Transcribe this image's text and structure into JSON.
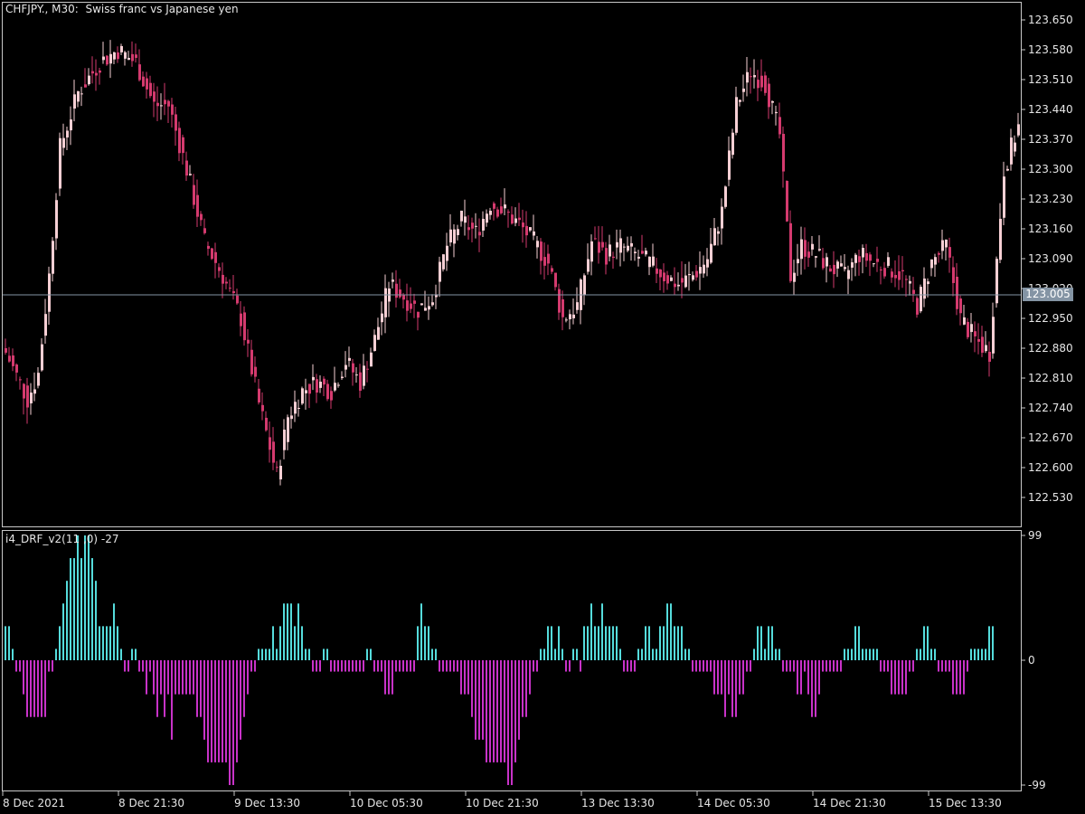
{
  "header": {
    "symbol_label": "CHFJPY., M30:",
    "description": "Swiss franc vs Japanese yen"
  },
  "indicator": {
    "label": "i4_DRF_v2(11 ,0) -27"
  },
  "current_price": "123.005",
  "colors": {
    "background": "#000000",
    "frame": "#c8c8c8",
    "bear_candle": "#d43a6e",
    "bull_candle": "#f6cfd4",
    "price_line": "#8494a4",
    "hist_positive": "#55dcdc",
    "hist_negative": "#c832c8"
  },
  "chart_data": [
    {
      "type": "candlestick",
      "title": "CHFJPY., M30:  Swiss franc vs Japanese yen",
      "ylim": [
        122.47,
        123.71
      ],
      "y_ticks": [
        "123.650",
        "123.580",
        "123.510",
        "123.440",
        "123.370",
        "123.300",
        "123.230",
        "123.160",
        "123.090",
        "123.020",
        "122.950",
        "122.880",
        "122.810",
        "122.740",
        "122.670",
        "122.600",
        "122.530"
      ],
      "x_ticks": [
        "8 Dec 2021",
        "8 Dec 21:30",
        "9 Dec 13:30",
        "10 Dec 05:30",
        "10 Dec 21:30",
        "13 Dec 13:30",
        "14 Dec 05:30",
        "14 Dec 21:30",
        "15 Dec 13:30"
      ],
      "close_anchors": [
        {
          "bar": 0,
          "close": 122.87
        },
        {
          "bar": 6,
          "close": 122.76
        },
        {
          "bar": 9,
          "close": 122.82
        },
        {
          "bar": 12,
          "close": 123.05
        },
        {
          "bar": 15,
          "close": 123.35
        },
        {
          "bar": 20,
          "close": 123.48
        },
        {
          "bar": 26,
          "close": 123.55
        },
        {
          "bar": 31,
          "close": 123.58
        },
        {
          "bar": 36,
          "close": 123.55
        },
        {
          "bar": 41,
          "close": 123.45
        },
        {
          "bar": 45,
          "close": 123.45
        },
        {
          "bar": 50,
          "close": 123.3
        },
        {
          "bar": 55,
          "close": 123.13
        },
        {
          "bar": 60,
          "close": 123.05
        },
        {
          "bar": 65,
          "close": 122.95
        },
        {
          "bar": 70,
          "close": 122.75
        },
        {
          "bar": 75,
          "close": 122.58
        },
        {
          "bar": 78,
          "close": 122.72
        },
        {
          "bar": 82,
          "close": 122.78
        },
        {
          "bar": 86,
          "close": 122.8
        },
        {
          "bar": 90,
          "close": 122.78
        },
        {
          "bar": 94,
          "close": 122.85
        },
        {
          "bar": 98,
          "close": 122.8
        },
        {
          "bar": 102,
          "close": 122.9
        },
        {
          "bar": 106,
          "close": 123.03
        },
        {
          "bar": 110,
          "close": 123.0
        },
        {
          "bar": 114,
          "close": 122.97
        },
        {
          "bar": 118,
          "close": 123.0
        },
        {
          "bar": 122,
          "close": 123.12
        },
        {
          "bar": 126,
          "close": 123.18
        },
        {
          "bar": 130,
          "close": 123.15
        },
        {
          "bar": 134,
          "close": 123.22
        },
        {
          "bar": 138,
          "close": 123.2
        },
        {
          "bar": 142,
          "close": 123.17
        },
        {
          "bar": 146,
          "close": 123.13
        },
        {
          "bar": 150,
          "close": 123.08
        },
        {
          "bar": 154,
          "close": 122.95
        },
        {
          "bar": 158,
          "close": 122.98
        },
        {
          "bar": 162,
          "close": 123.13
        },
        {
          "bar": 166,
          "close": 123.1
        },
        {
          "bar": 170,
          "close": 123.12
        },
        {
          "bar": 174,
          "close": 123.1
        },
        {
          "bar": 178,
          "close": 123.08
        },
        {
          "bar": 182,
          "close": 123.05
        },
        {
          "bar": 186,
          "close": 123.03
        },
        {
          "bar": 190,
          "close": 123.05
        },
        {
          "bar": 194,
          "close": 123.09
        },
        {
          "bar": 198,
          "close": 123.2
        },
        {
          "bar": 202,
          "close": 123.45
        },
        {
          "bar": 206,
          "close": 123.53
        },
        {
          "bar": 210,
          "close": 123.5
        },
        {
          "bar": 214,
          "close": 123.38
        },
        {
          "bar": 217,
          "close": 123.05
        },
        {
          "bar": 220,
          "close": 123.12
        },
        {
          "bar": 224,
          "close": 123.1
        },
        {
          "bar": 228,
          "close": 123.07
        },
        {
          "bar": 232,
          "close": 123.05
        },
        {
          "bar": 236,
          "close": 123.1
        },
        {
          "bar": 240,
          "close": 123.08
        },
        {
          "bar": 244,
          "close": 123.07
        },
        {
          "bar": 248,
          "close": 123.05
        },
        {
          "bar": 252,
          "close": 122.98
        },
        {
          "bar": 256,
          "close": 123.08
        },
        {
          "bar": 260,
          "close": 123.12
        },
        {
          "bar": 264,
          "close": 122.95
        },
        {
          "bar": 268,
          "close": 122.9
        },
        {
          "bar": 272,
          "close": 122.87
        },
        {
          "bar": 276,
          "close": 123.3
        },
        {
          "bar": 280,
          "close": 123.4
        }
      ]
    },
    {
      "type": "bar",
      "title": "i4_DRF_v2(11 ,0) -27",
      "ylim": [
        -99,
        99
      ],
      "y_ticks": [
        "99",
        "0",
        "-99"
      ],
      "values": [
        27,
        27,
        9,
        -9,
        -9,
        -27,
        -45,
        -45,
        -45,
        -45,
        -45,
        -45,
        -9,
        -9,
        9,
        27,
        45,
        63,
        81,
        81,
        99,
        81,
        99,
        99,
        81,
        63,
        27,
        27,
        27,
        27,
        45,
        27,
        9,
        -9,
        -9,
        9,
        9,
        -9,
        -9,
        -27,
        -9,
        -27,
        -45,
        -27,
        -45,
        -27,
        -63,
        -27,
        -27,
        -27,
        -27,
        -27,
        -27,
        -45,
        -45,
        -63,
        -81,
        -81,
        -81,
        -81,
        -81,
        -81,
        -99,
        -99,
        -81,
        -63,
        -45,
        -27,
        -9,
        -9,
        9,
        9,
        9,
        9,
        27,
        9,
        27,
        45,
        45,
        45,
        27,
        45,
        27,
        9,
        9,
        -9,
        -9,
        -9,
        9,
        9,
        -9,
        -9,
        -9,
        -9,
        -9,
        -9,
        -9,
        -9,
        -9,
        -9,
        9,
        9,
        -9,
        -9,
        -9,
        -27,
        -27,
        -27,
        -9,
        -9,
        -9,
        -9,
        -9,
        -9,
        27,
        45,
        27,
        27,
        9,
        9,
        -9,
        -9,
        -9,
        -9,
        -9,
        -9,
        -27,
        -27,
        -27,
        -45,
        -63,
        -63,
        -63,
        -81,
        -81,
        -81,
        -81,
        -81,
        -81,
        -99,
        -99,
        -81,
        -63,
        -45,
        -45,
        -27,
        -9,
        -9,
        9,
        9,
        27,
        27,
        9,
        27,
        9,
        -9,
        -9,
        9,
        9,
        -9,
        27,
        27,
        45,
        27,
        27,
        45,
        27,
        27,
        27,
        27,
        9,
        -9,
        -9,
        -9,
        -9,
        9,
        9,
        27,
        27,
        9,
        9,
        27,
        27,
        45,
        45,
        27,
        27,
        27,
        9,
        9,
        -9,
        -9,
        -9,
        -9,
        -9,
        -9,
        -27,
        -27,
        -27,
        -45,
        -27,
        -45,
        -45,
        -27,
        -27,
        -9,
        -9,
        9,
        27,
        27,
        9,
        27,
        27,
        9,
        9,
        -9,
        -9,
        -9,
        -9,
        -27,
        -27,
        -9,
        -27,
        -45,
        -45,
        -27,
        -9,
        -9,
        -9,
        -9,
        -9,
        -9,
        9,
        9,
        9,
        27,
        27,
        9,
        9,
        9,
        9,
        9,
        -9,
        -9,
        -9,
        -27,
        -27,
        -27,
        -27,
        -27,
        -9,
        -9,
        9,
        9,
        27,
        27,
        9,
        9,
        -9,
        -9,
        -9,
        -9,
        -27,
        -27,
        -27,
        -27,
        -9,
        9,
        9,
        9,
        9,
        9,
        27,
        27
      ]
    }
  ]
}
